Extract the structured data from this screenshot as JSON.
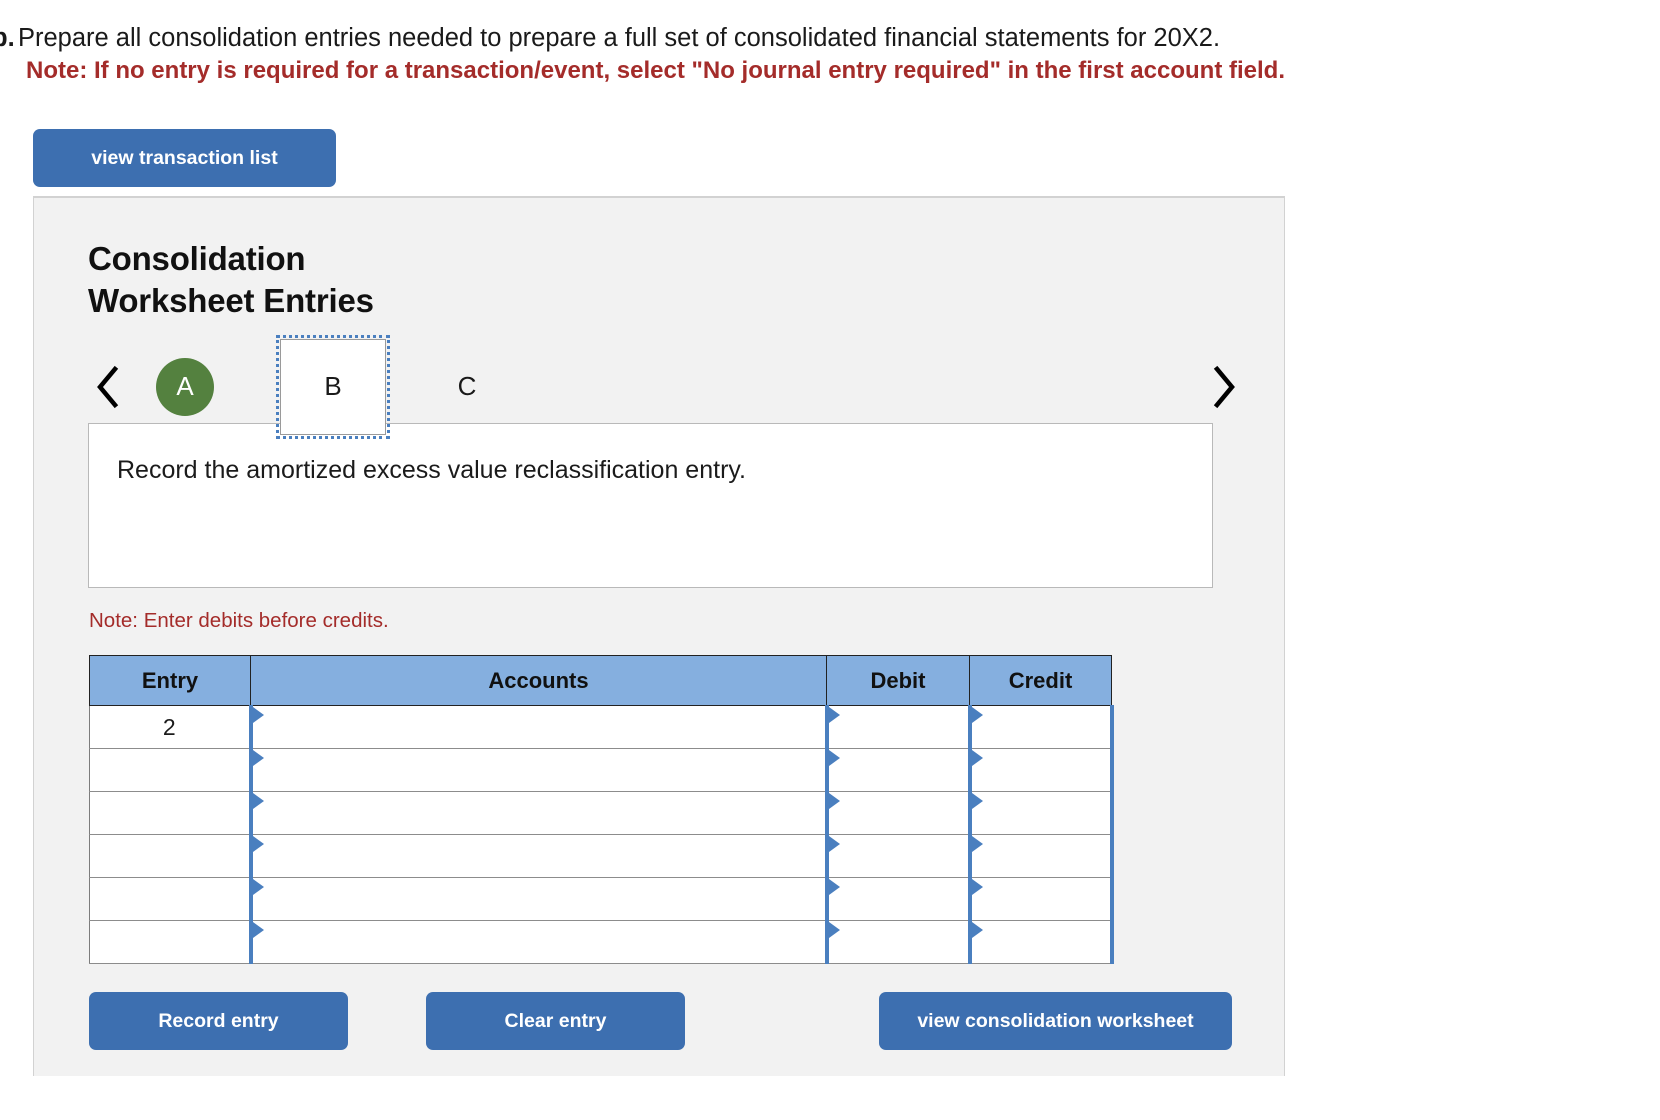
{
  "prompt": {
    "letter": "b.",
    "question": "Prepare all consolidation entries needed to prepare a full set of consolidated financial statements for 20X2.",
    "note": "Note: If no entry is required for a transaction/event, select \"No journal entry required\" in the first account field."
  },
  "toolbar": {
    "view_transaction_list_label": "view transaction list"
  },
  "panel": {
    "title_line1": "Consolidation",
    "title_line2": "Worksheet Entries",
    "nav": {
      "prev_icon": "chevron-left-icon",
      "next_icon": "chevron-right-icon"
    },
    "tabs": [
      {
        "label": "A",
        "state": "completed"
      },
      {
        "label": "B",
        "state": "active"
      },
      {
        "label": "C",
        "state": "pending"
      }
    ],
    "description": "Record the amortized excess value reclassification entry.",
    "note_debits": "Note: Enter debits before credits."
  },
  "table": {
    "headers": [
      "Entry",
      "Accounts",
      "Debit",
      "Credit"
    ],
    "rows": [
      {
        "entry": "2",
        "accounts": "",
        "debit": "",
        "credit": ""
      },
      {
        "entry": "",
        "accounts": "",
        "debit": "",
        "credit": ""
      },
      {
        "entry": "",
        "accounts": "",
        "debit": "",
        "credit": ""
      },
      {
        "entry": "",
        "accounts": "",
        "debit": "",
        "credit": ""
      },
      {
        "entry": "",
        "accounts": "",
        "debit": "",
        "credit": ""
      },
      {
        "entry": "",
        "accounts": "",
        "debit": "",
        "credit": ""
      }
    ]
  },
  "footer": {
    "record_label": "Record entry",
    "clear_label": "Clear entry",
    "worksheet_label": "view consolidation worksheet"
  },
  "colors": {
    "button_blue": "#3d6fb0",
    "tab_green": "#54813f",
    "header_blue": "#85afdf",
    "note_red": "#a42c2a",
    "panel_bg": "#f2f2f2",
    "field_border_blue": "#4a7fbf"
  }
}
